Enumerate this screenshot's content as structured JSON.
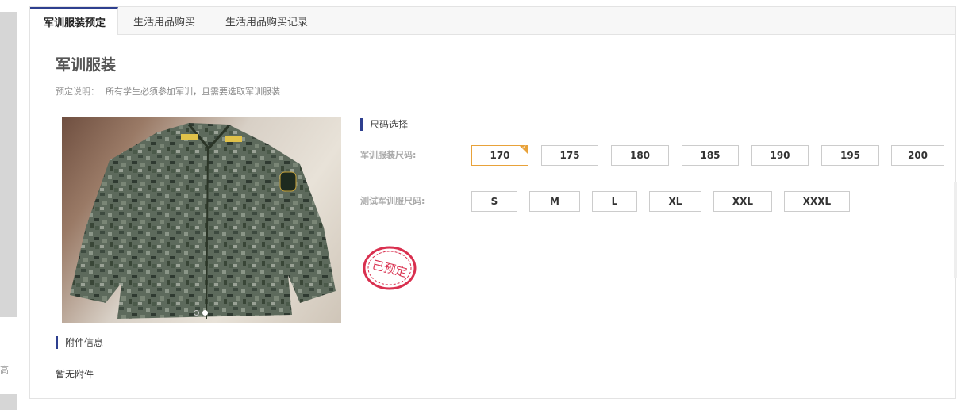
{
  "tabs": [
    {
      "label": "军训服装预定",
      "active": true
    },
    {
      "label": "生活用品购买",
      "active": false
    },
    {
      "label": "生活用品购买记录",
      "active": false
    }
  ],
  "page": {
    "title": "军训服装",
    "desc_label": "预定说明：",
    "desc_value": "所有学生必须参加军训，且需要选取军训服装"
  },
  "size_section": {
    "title": "尺码选择"
  },
  "uniform_sizes": {
    "label": "军训服装尺码:",
    "options": [
      "170",
      "175",
      "180",
      "185",
      "190",
      "195",
      "200"
    ],
    "selected": "170"
  },
  "test_sizes": {
    "label": "测试军训服尺码:",
    "options": [
      "S",
      "M",
      "L",
      "XL",
      "XXL",
      "XXXL"
    ]
  },
  "stamp": {
    "text": "已预定",
    "color": "#d9304f"
  },
  "attachment": {
    "title": "附件信息",
    "empty_text": "暂无附件"
  },
  "carousel": {
    "slide_count": 2,
    "current_slide": 2
  },
  "left_glyph": "高",
  "colors": {
    "accent": "#2e3f8f",
    "selected": "#e8a23a"
  }
}
